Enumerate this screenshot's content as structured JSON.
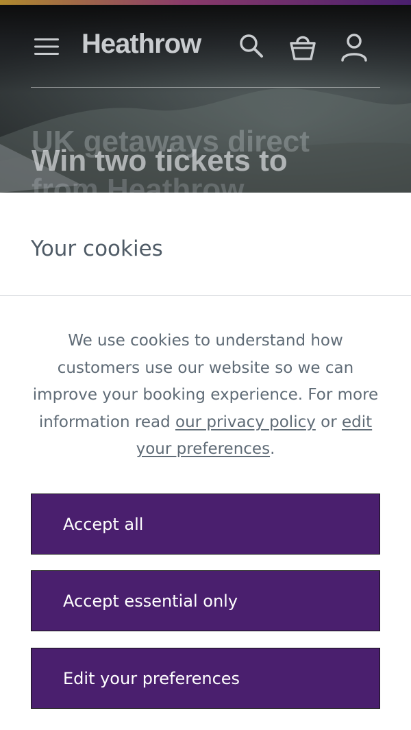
{
  "header": {
    "logo_text": "Heathrow",
    "icons": {
      "menu": "menu-icon",
      "search": "search-icon",
      "basket": "shopping-bag-icon",
      "account": "account-icon"
    },
    "hero_titles": {
      "background_1": "UK getaways direct",
      "foreground": "Win two tickets to",
      "background_2": "from Heathrow"
    }
  },
  "cookie_banner": {
    "title": "Your cookies",
    "text_before_link": "We use cookies to understand how customers use our website so we can improve your booking experience. For more information read ",
    "privacy_link": "our privacy policy",
    "text_middle": " or ",
    "preferences_link": "edit your preferences",
    "text_after": ".",
    "buttons": {
      "accept_all": "Accept all",
      "accept_essential": "Accept essential only",
      "edit_preferences": "Edit your preferences"
    }
  },
  "colors": {
    "brand_purple": "#4a1f6e",
    "heading_text": "#4f5b66",
    "body_text": "#5f6b76"
  }
}
